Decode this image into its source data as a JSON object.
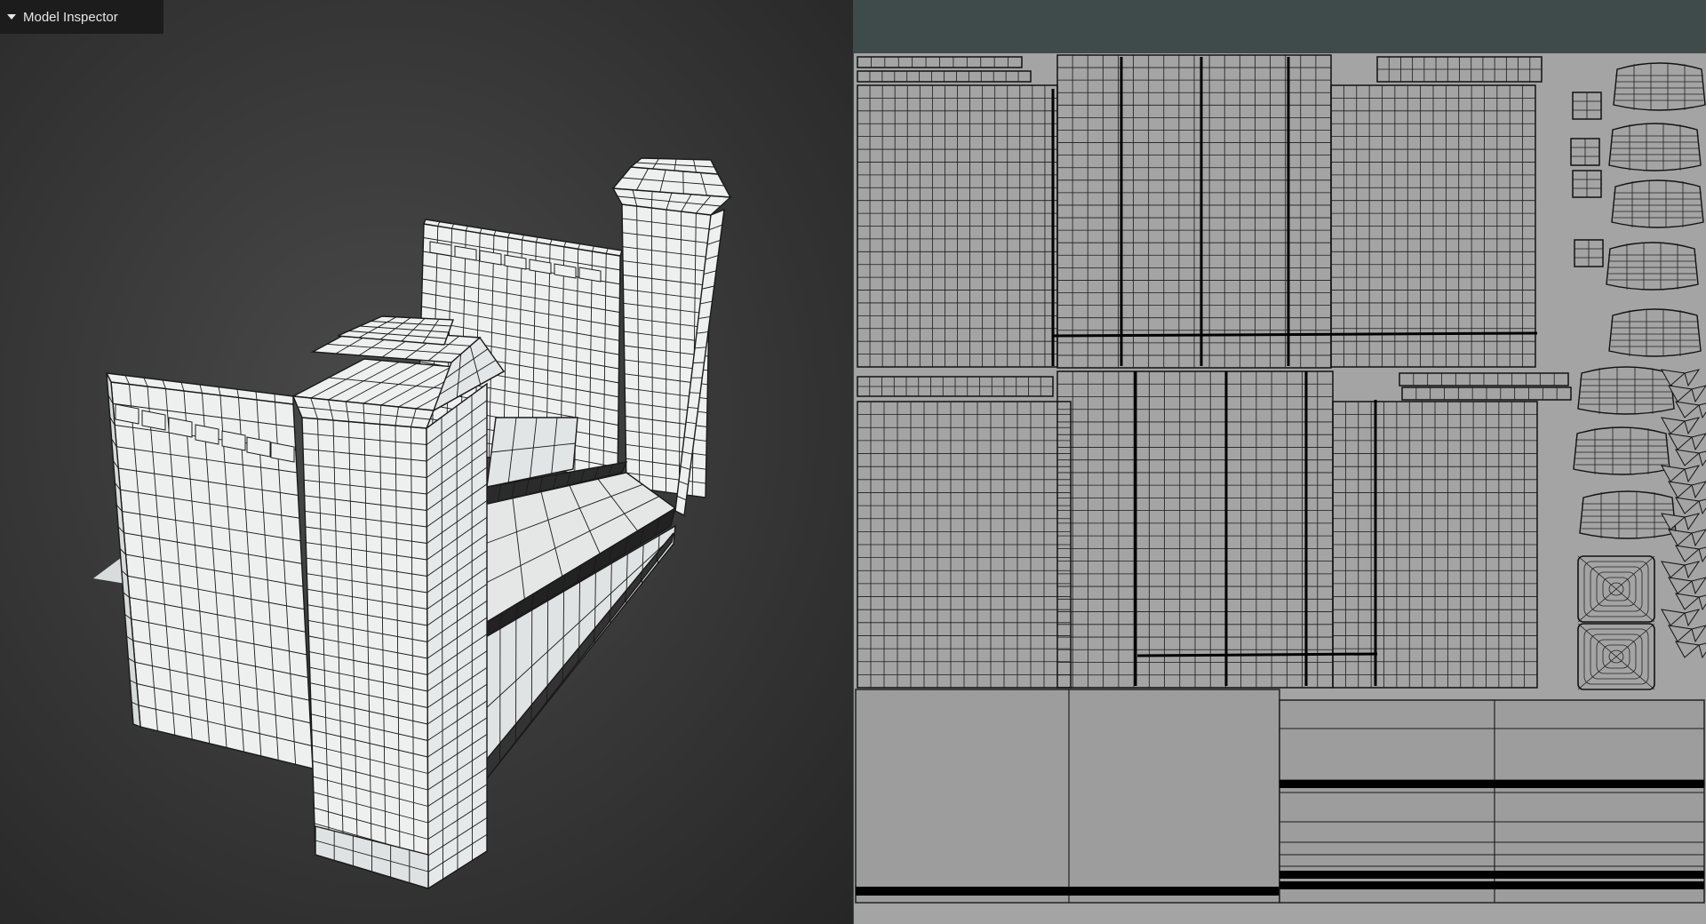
{
  "panel": {
    "title": "Model Inspector",
    "collapse_icon": "caret-down-icon"
  },
  "colors": {
    "viewport_bg": "#3a3a3a",
    "mesh_face": "#eef0f0",
    "wire": "#1a1a1a",
    "uv_editor_bg": "#3f4b4a",
    "uv_sheet": "#a4a4a4",
    "inspector_bg": "#1c1c1c"
  }
}
